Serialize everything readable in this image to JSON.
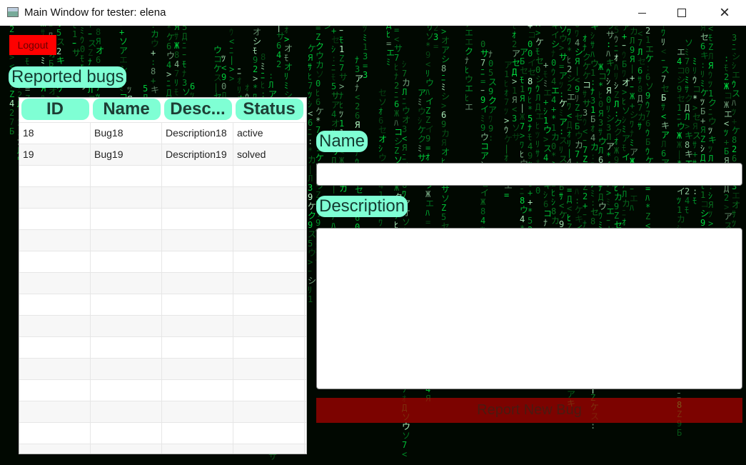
{
  "window": {
    "title": "Main Window for tester: elena",
    "minimize": "minimize-icon",
    "maximize": "maximize-icon",
    "close": "×"
  },
  "toolbar": {
    "logout_label": "Logout"
  },
  "bugs": {
    "heading": "Reported bugs",
    "columns": [
      "ID",
      "Name",
      "Desc...",
      "Status"
    ],
    "rows": [
      [
        "18",
        "Bug18",
        "Description18",
        "active"
      ],
      [
        "19",
        "Bug19",
        "Description19",
        "solved"
      ]
    ]
  },
  "form": {
    "name_label": "Name",
    "name_value": "",
    "description_label": "Description",
    "description_value": "",
    "submit_label": "Report New Bug"
  },
  "colors": {
    "accent": "#7fffd4",
    "logout": "#ff0000",
    "submit": "#c80000",
    "matrix_green": "#00ff41"
  }
}
